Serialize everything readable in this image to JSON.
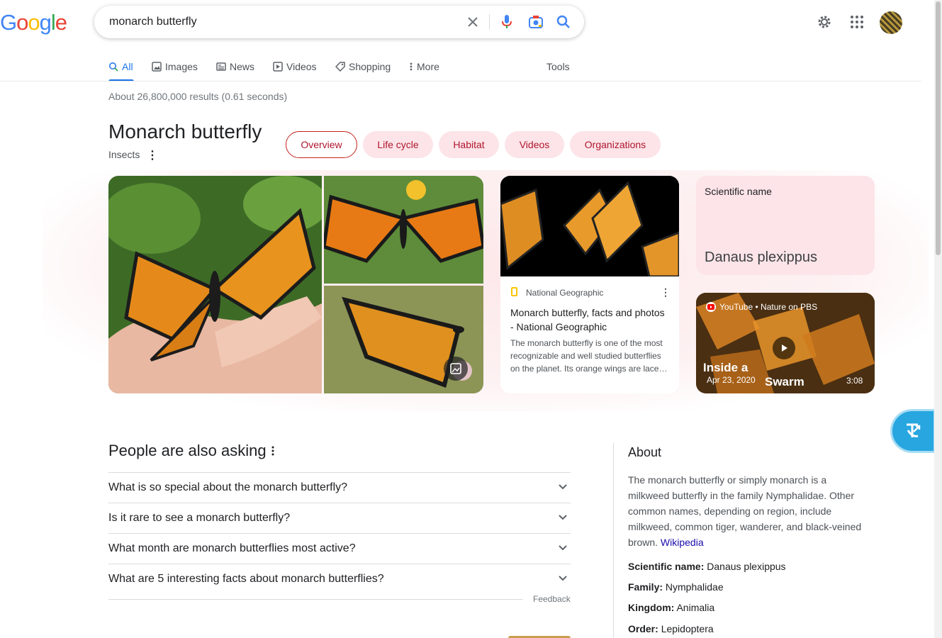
{
  "logo": {
    "text": "Google",
    "letters": [
      {
        "ch": "G",
        "color": "#4285f4"
      },
      {
        "ch": "o",
        "color": "#ea4335"
      },
      {
        "ch": "o",
        "color": "#fbbc05"
      },
      {
        "ch": "g",
        "color": "#4285f4"
      },
      {
        "ch": "l",
        "color": "#34a853"
      },
      {
        "ch": "e",
        "color": "#ea4335"
      }
    ]
  },
  "search": {
    "query": "monarch butterfly"
  },
  "tabs": [
    {
      "label": "All",
      "icon": "search-icon",
      "active": true
    },
    {
      "label": "Images",
      "icon": "image-icon"
    },
    {
      "label": "News",
      "icon": "news-icon"
    },
    {
      "label": "Videos",
      "icon": "play-icon"
    },
    {
      "label": "Shopping",
      "icon": "tag-icon"
    },
    {
      "label": "More",
      "icon": "more-vert-icon"
    }
  ],
  "tools_label": "Tools",
  "stats": "About 26,800,000 results (0.61 seconds)",
  "knowledge": {
    "title": "Monarch butterfly",
    "subtitle": "Insects",
    "chips": [
      "Overview",
      "Life cycle",
      "Habitat",
      "Videos",
      "Organizations"
    ],
    "selected_chip": "Overview",
    "article": {
      "source": "National Geographic",
      "title": "Monarch butterfly, facts and photos - National Geographic",
      "desc": "The monarch butterfly is one of the most recognizable and well studied butterflies on the planet. Its orange wings are lace…"
    },
    "sci": {
      "label": "Scientific name",
      "value": "Danaus plexippus"
    },
    "video": {
      "source": "YouTube • Nature on PBS",
      "caption_a": "Inside a",
      "caption_b": "Swarm",
      "date": "Apr 23, 2020",
      "duration": "3:08"
    }
  },
  "paa": {
    "title": "People are also asking",
    "questions": [
      "What is so special about the monarch butterfly?",
      "Is it rare to see a monarch butterfly?",
      "What month are monarch butterflies most active?",
      "What are 5 interesting facts about monarch butterflies?"
    ],
    "feedback": "Feedback"
  },
  "about": {
    "title": "About",
    "desc": "The monarch butterfly or simply monarch is a milkweed butterfly in the family Nymphalidae. Other common names, depending on region, include milkweed, common tiger, wanderer, and black-veined brown.",
    "link": "Wikipedia",
    "facts": [
      {
        "k": "Scientific name:",
        "v": "Danaus plexippus"
      },
      {
        "k": "Family:",
        "v": "Nymphalidae"
      },
      {
        "k": "Kingdom:",
        "v": "Animalia"
      },
      {
        "k": "Order:",
        "v": "Lepidoptera"
      }
    ]
  },
  "colors": {
    "accent": "#1a73e8",
    "chip_bg": "#fce4e8",
    "chip_text": "#b0162e",
    "link": "#1a0dab"
  }
}
